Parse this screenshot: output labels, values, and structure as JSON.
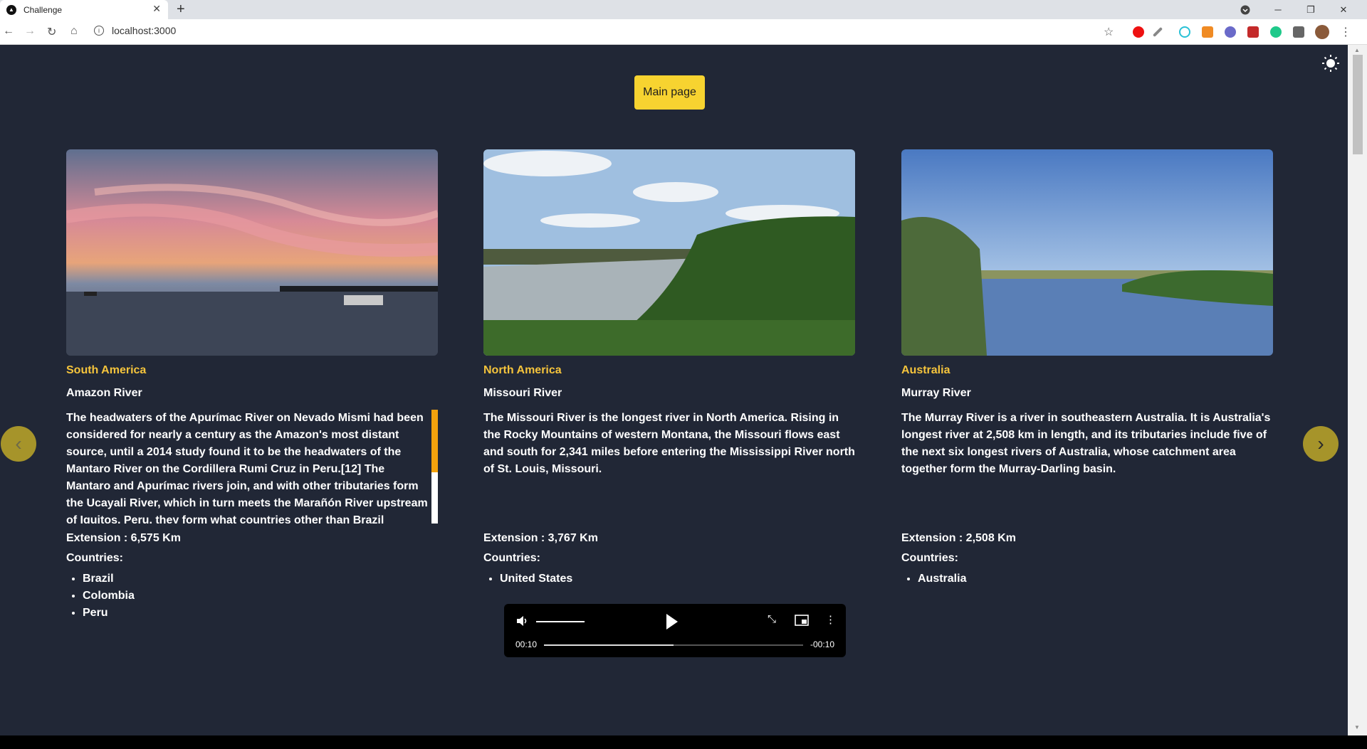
{
  "browser": {
    "tab_title": "Challenge",
    "url": "localhost:3000"
  },
  "page": {
    "main_button": "Main page",
    "cards": [
      {
        "region": "South America",
        "name": "Amazon River",
        "description": "The headwaters of the Apurímac River on Nevado Mismi had been considered for nearly a century as the Amazon's most distant source, until a 2014 study found it to be the headwaters of the Mantaro River on the Cordillera Rumi Cruz in Peru.[12] The Mantaro and Apurímac rivers join, and with other tributaries form the Ucayali River, which in turn meets the Marañón River upstream of Iquitos, Peru, they form what countries other than Brazil",
        "extension": "Extension : 6,575 Km",
        "countries_label": "Countries:",
        "countries": [
          "Brazil",
          "Colombia",
          "Peru"
        ]
      },
      {
        "region": "North America",
        "name": "Missouri River",
        "description": "The Missouri River is the longest river in North America. Rising in the Rocky Mountains of western Montana, the Missouri flows east and south for 2,341 miles before entering the Mississippi River north of St. Louis, Missouri.",
        "extension": "Extension : 3,767 Km",
        "countries_label": "Countries:",
        "countries": [
          "United States"
        ]
      },
      {
        "region": "Australia",
        "name": "Murray River",
        "description": "The Murray River is a river in southeastern Australia. It is Australia's longest river at 2,508 km in length, and its tributaries include five of the next six longest rivers of Australia, whose catchment area together form the Murray-Darling basin.",
        "extension": "Extension : 2,508 Km",
        "countries_label": "Countries:",
        "countries": [
          "Australia"
        ]
      }
    ],
    "player": {
      "current_time": "00:10",
      "remaining_time": "-00:10",
      "progress": 0.5
    }
  }
}
